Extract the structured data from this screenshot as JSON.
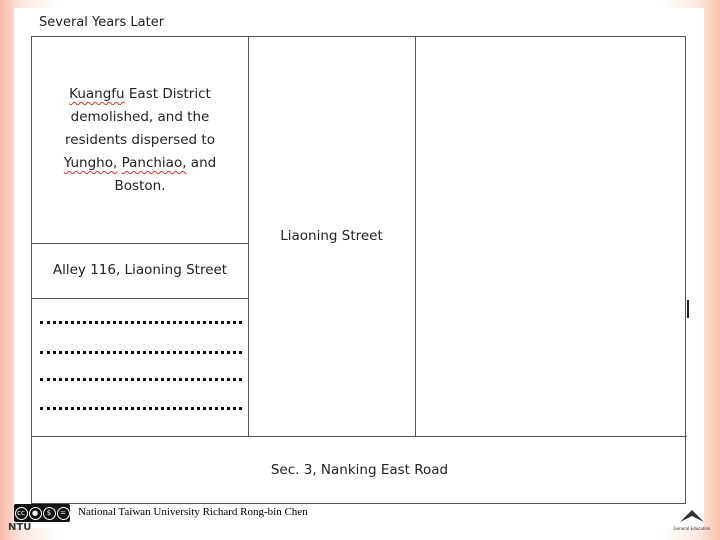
{
  "slide": {
    "heading": "Several Years Later"
  },
  "map": {
    "district_lines": [
      "Kuangfu",
      "East District",
      "demolished,  and the",
      "residents dispersed to",
      "Yungho,",
      "Panchiao,",
      "and",
      "Boston."
    ],
    "alley_label": "Alley 116, Liaoning  Street",
    "street_label": "Liaoning  Street",
    "road_label": "Sec. 3, Nanking  East Road"
  },
  "footer": {
    "credit": "National Taiwan University Richard Rong-bin Chen",
    "license_label": "cc",
    "ntu_text": "NTU",
    "ge_text": "General Education"
  }
}
